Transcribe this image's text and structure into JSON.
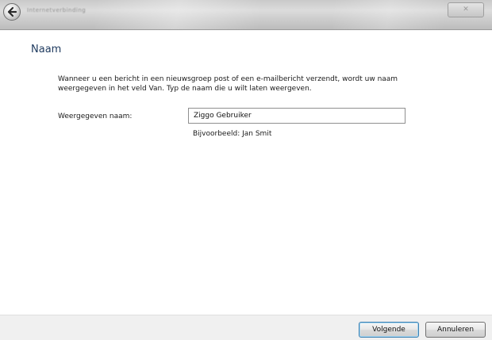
{
  "window": {
    "title": "Internetverbinding",
    "close_label": "✕"
  },
  "page": {
    "heading": "Naam",
    "description": "Wanneer u een bericht in een nieuwsgroep post of een e-mailbericht verzendt, wordt uw naam weergegeven in het veld Van. Typ de naam die u wilt laten weergeven.",
    "display_name_label": "Weergegeven naam:",
    "display_name_value": "Ziggo Gebruiker",
    "example": "Bijvoorbeeld: Jan Smit"
  },
  "footer": {
    "next_label": "Volgende",
    "cancel_label": "Annuleren"
  },
  "icons": {
    "back": "back-arrow-icon"
  }
}
